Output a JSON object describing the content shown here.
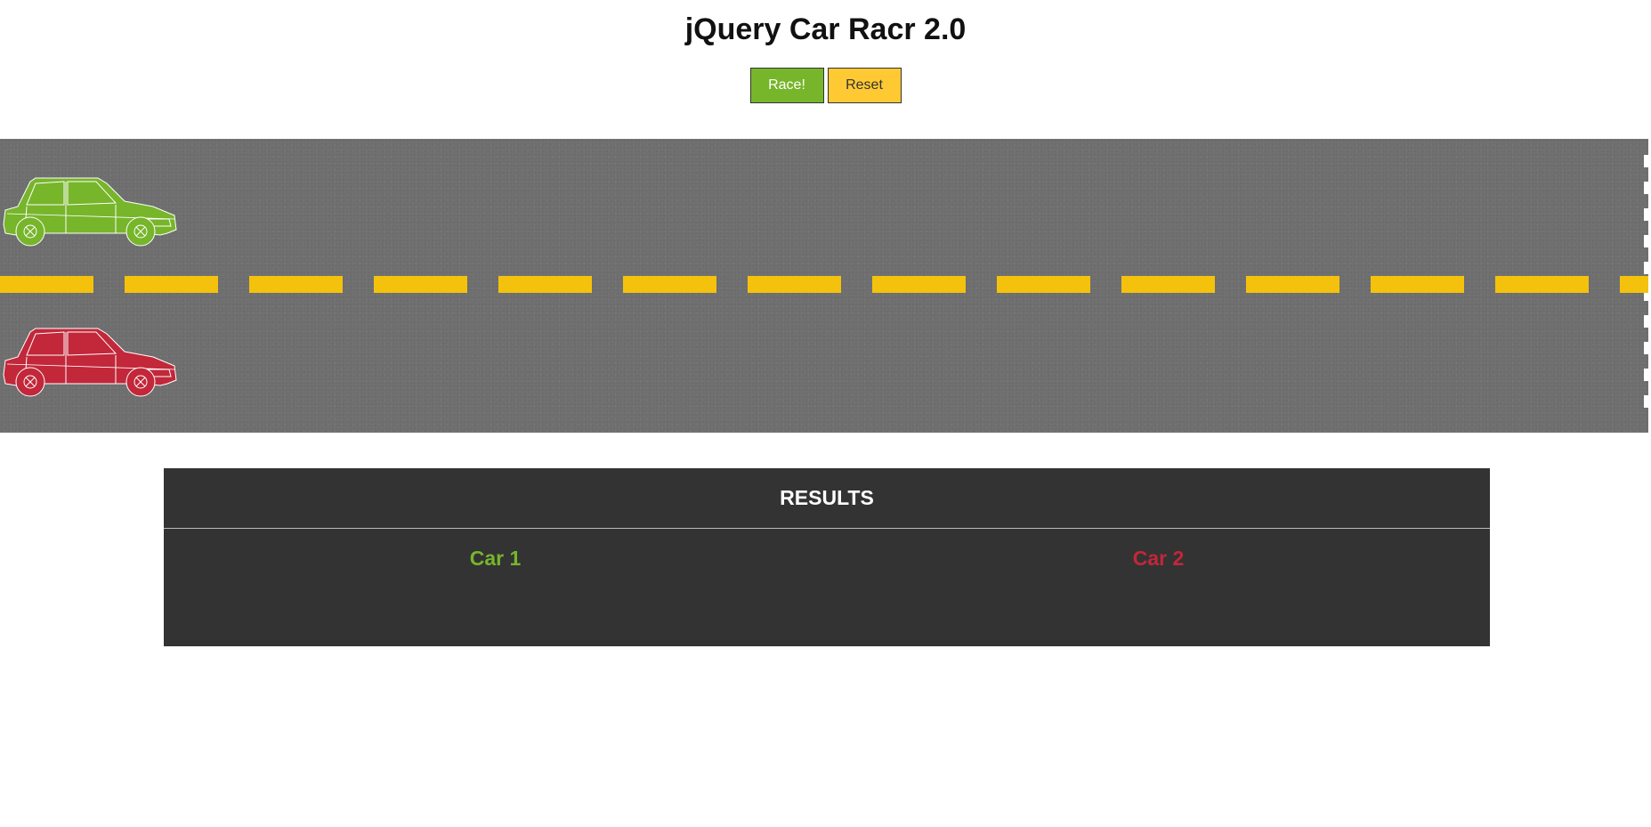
{
  "page": {
    "title": "jQuery Car Racr 2.0"
  },
  "controls": {
    "race_label": "Race!",
    "reset_label": "Reset"
  },
  "track": {
    "cars": [
      {
        "name": "car-1",
        "color": "#77b52b"
      },
      {
        "name": "car-2",
        "color": "#c2273a"
      }
    ],
    "lane_divider_color": "#f4c20d",
    "asphalt_color": "#707070"
  },
  "results": {
    "heading": "RESULTS",
    "car1_label": "Car 1",
    "car2_label": "Car 2",
    "car1_color": "#77b52b",
    "car2_color": "#c2273a"
  }
}
